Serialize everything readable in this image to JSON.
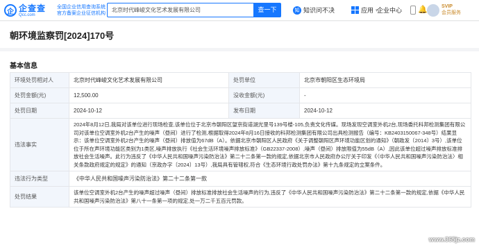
{
  "header": {
    "logo_mark": "企",
    "logo_name": "企查查",
    "logo_domain": "Qcc.com",
    "tagline_line1": "全国企业信用查询系统",
    "tagline_line2": "官方备案企业征信机构",
    "search_value": "北京时代峰峻文化艺术发展有限公司",
    "search_button": "查一下",
    "nav_items": [
      {
        "label": "知识问不决",
        "icon": "knowledge-icon"
      },
      {
        "label": "应用",
        "icon": "apps-grid-icon"
      },
      {
        "label": "企业中心"
      }
    ],
    "svip_line1": "SVIP",
    "svip_line2": "会员服务"
  },
  "page": {
    "title": "朝环境监察罚[2024]170号"
  },
  "basic_info": {
    "section_title": "基本信息",
    "labels": {
      "party": "环境处罚相对人",
      "dept": "处罚单位",
      "amount": "处罚金额(元)",
      "confiscated": "没收金额(元)",
      "date": "处罚日期",
      "publish_date": "发布日期",
      "facts": "违法事实",
      "violation_type": "违法行为类型",
      "result": "处罚结果"
    },
    "values": {
      "party": "北京时代峰峻文化艺术发展有限公司",
      "dept": "北京市朝阳区生态环境局",
      "amount": "12,500.00",
      "confiscated": "-",
      "date": "2024-10-12",
      "publish_date": "2024-10-12",
      "facts": "2024年8月12日,我局对该单位进行现场检查,该单位位于北京市朝阳区望京街道湖光里号139号楼-105,负责文化传媒。现场发现空调室外机2台,现场委托科邦检测集团有限公司对该单位空调室外机2台产生的噪声（昼间）进行了检测,根据取得2024年8月16日接收的科邦检测集团有限公司出具检测报告（编号：KB2403150067-348号）结果显示：该单位空调室外机2台产生的噪声（昼间）排放值为67dB（A）。依据北京市朝阳区人民政府《关于调整朝阳区声环境功能区划的通知》（朝政发〔2014〕3号）,该单位位于所在声环境功能区类别为1类区,噪声排放执行《社会生活环境噪声排放标准》（GB22337-2008）,噪声（昼间）排放限值为55dB（A）,因此该单位超过噪声排放标准排放社会生活噪声。此行为违反了《中华人民共和国噪声污染防治法》第二十二条第一款的规定,依据北京市人民政府办公厅关于印发《〈中华人民共和国噪声污染防治法〉相关条款政府规定的规定》的通知（京政办字〔2024〕13号）,我局具有管辖权,符合《生态环境行政处罚办法》第十九条规定的立案条件。",
      "violation_type": "《中华人民共和国噪声污染防治法》第二十二条第一款",
      "result": "该单位空调室外机2台产生的噪声超过噪声（昼间）排放标准排放社会生活噪声的行为,违反了《中华人民共和国噪声污染防治法》第二十二条第一款的规定,依据《中华人民共和国噪声污染防治法》第八十一条第一项的规定,处一万二千五百元罚款。"
    }
  },
  "watermark": "www.365jz.com",
  "colors": {
    "accent": "#1677ff",
    "label_bg": "#f2f6fc",
    "page_bg": "#f3f4f6"
  }
}
